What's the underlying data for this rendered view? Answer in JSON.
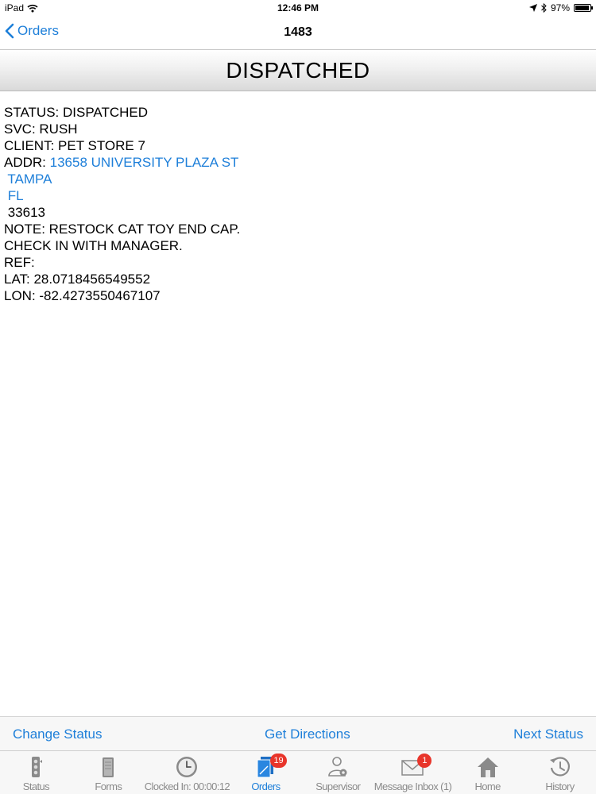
{
  "status_bar": {
    "device": "iPad",
    "time": "12:46 PM",
    "battery": "97%"
  },
  "nav": {
    "back_label": "Orders",
    "title": "1483"
  },
  "header": {
    "title": "DISPATCHED"
  },
  "details": {
    "status": "STATUS: DISPATCHED",
    "svc": "SVC: RUSH",
    "client": "CLIENT: PET STORE 7",
    "addr_label": "ADDR: ",
    "addr_street": "13658 UNIVERSITY PLAZA ST",
    "addr_city": " TAMPA",
    "addr_state": " FL",
    "addr_zip": " 33613",
    "note": "NOTE: RESTOCK CAT TOY END CAP.",
    "note_line2": "CHECK IN WITH MANAGER.",
    "ref": "REF:",
    "lat": "LAT: 28.0718456549552",
    "lon": "LON: -82.4273550467107"
  },
  "actions": {
    "change_status": "Change Status",
    "get_directions": "Get Directions",
    "next_status": "Next Status"
  },
  "tabs": [
    {
      "label": "Status",
      "icon": "traffic-light-icon"
    },
    {
      "label": "Forms",
      "icon": "document-icon"
    },
    {
      "label": "Clocked In: 00:00:12",
      "icon": "clock-icon"
    },
    {
      "label": "Orders",
      "icon": "orders-icon",
      "badge": "19",
      "active": true
    },
    {
      "label": "Supervisor",
      "icon": "supervisor-icon"
    },
    {
      "label": "Message Inbox (1)",
      "icon": "envelope-icon",
      "badge": "1"
    },
    {
      "label": "Home",
      "icon": "home-icon"
    },
    {
      "label": "History",
      "icon": "history-icon"
    }
  ],
  "colors": {
    "accent": "#1e7fd9",
    "badge": "#e8352b",
    "inactive": "#8a8a8a"
  }
}
